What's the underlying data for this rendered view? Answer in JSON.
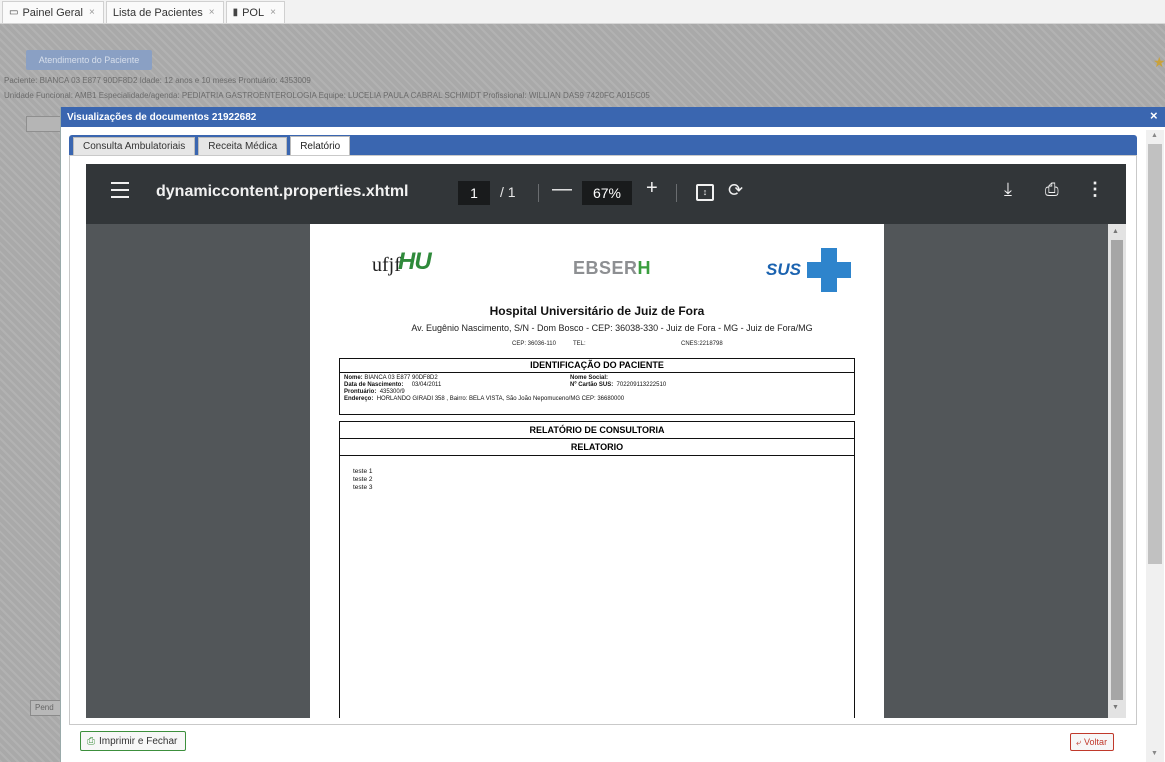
{
  "top_tabs": [
    {
      "label": "Painel Geral",
      "icon": "monitor-icon"
    },
    {
      "label": "Lista de Pacientes"
    },
    {
      "label": "POL",
      "icon": "folder-icon"
    }
  ],
  "background": {
    "button": "Atendimento do Paciente",
    "line1": "Paciente: BIANCA 03 E877 90DF8D2  Idade: 12 anos e 10 meses  Prontuário: 4353009",
    "line2": "Unidade Funcional: AMB1  Especialidade/agenda: PEDIATRIA GASTROENTEROLOGIA  Equipe: LUCELIA PAULA CABRAL SCHMIDT  Profissional: WILLIAN DAS9 7420FC A015C05",
    "pend_label": "Pend"
  },
  "modal": {
    "title": "Visualizações de documentos 21922682",
    "close": "×",
    "tabs": [
      "Consulta Ambulatoriais",
      "Receita Médica",
      "Relatório"
    ],
    "active_tab": "Relatório"
  },
  "pdf": {
    "filename": "dynamiccontent.properties.xhtml",
    "page": "1",
    "page_total": "/ 1",
    "zoom": "67%",
    "icons": [
      "menu-icon",
      "fit-page-icon",
      "rotate-icon",
      "download-icon",
      "print-icon",
      "more-icon"
    ]
  },
  "document": {
    "logos": {
      "ufjf": "ufjf",
      "hu": "HU",
      "ebserh": "EBSER",
      "ebserh_h": "H",
      "sus": "SUS"
    },
    "hospital": "Hospital Universitário de Juiz de Fora",
    "address": "Av. Eugênio Nascimento, S/N - Dom Bosco - CEP: 36038-330 - Juiz de Fora - MG - Juiz de Fora/MG",
    "cep": "CEP: 36036-110",
    "tel": "TEL:",
    "cnes": "CNES:2218798",
    "id_header": "IDENTIFICAÇÃO DO PACIENTE",
    "nome_label": "Nome:",
    "nome": "BIANCA 03 E877 90DF8D2",
    "nome_social_label": "Nome Social:",
    "nasc_label": "Data de Nascimento:",
    "nasc": "03/04/2011",
    "cartao_label": "Nº Cartão SUS:",
    "cartao": "702209113222510",
    "prontuario_label": "Prontuário:",
    "prontuario": "435300/9",
    "endereco_label": "Endereço:",
    "endereco": "HORLANDO GIRADI 358 , Bairro: BELA VISTA, São João Nepomuceno/MG CEP: 36680000",
    "report_header": "RELATÓRIO DE CONSULTORIA",
    "report_sub": "RELATORIO",
    "lines": [
      "teste 1",
      "teste 2",
      "teste 3"
    ]
  },
  "footer": {
    "print_close": "Imprimir e Fechar",
    "voltar": "Voltar"
  }
}
